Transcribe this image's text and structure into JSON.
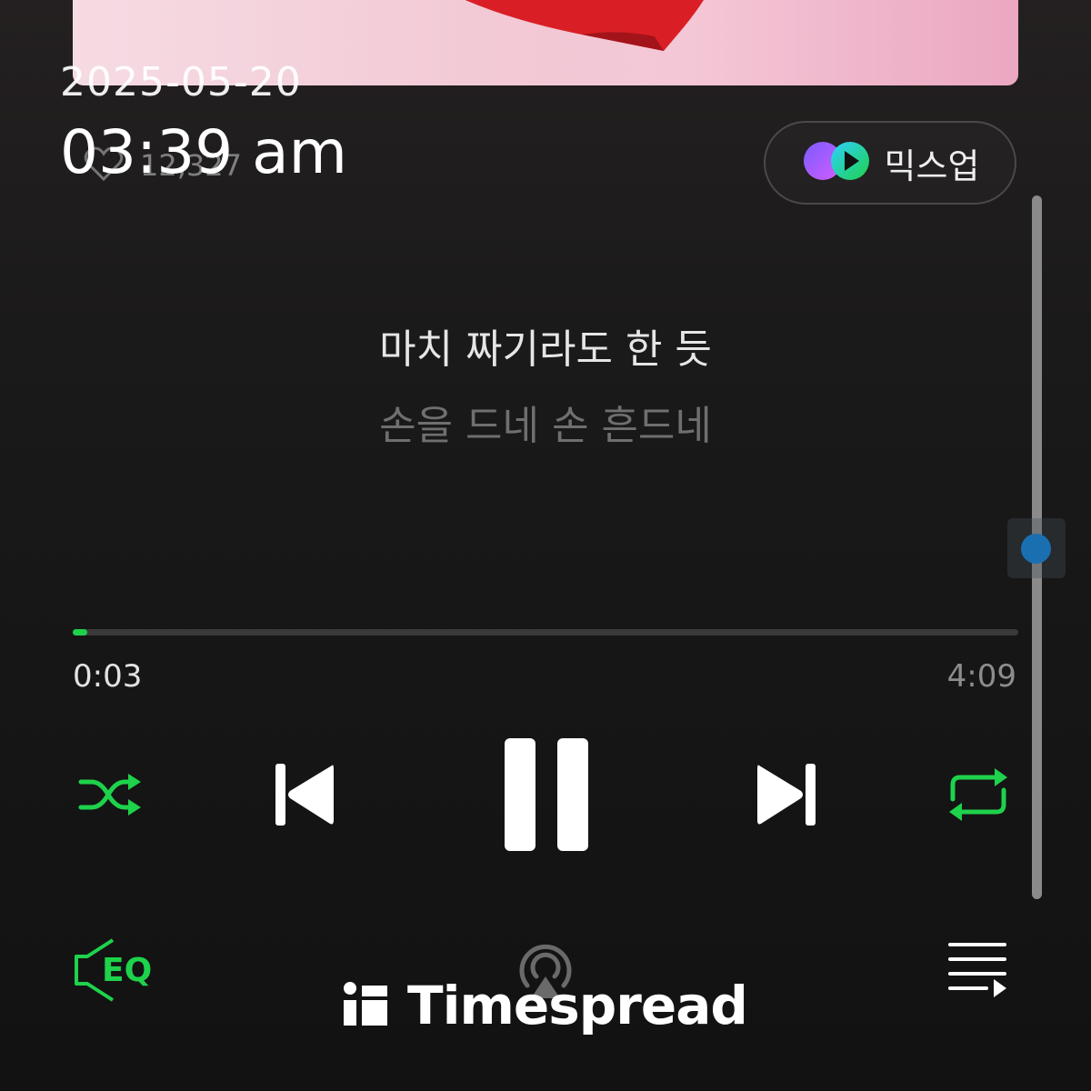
{
  "overlay": {
    "date": "2025-05-20",
    "time": "03:39 am"
  },
  "track": {
    "like_count": "12,327"
  },
  "mixup": {
    "label": "믹스업"
  },
  "lyrics": {
    "current": "마치 짜기라도 한 듯",
    "next": "손을 드네 손 흔드네"
  },
  "playback": {
    "elapsed": "0:03",
    "total": "4:09",
    "progress_fraction": 0.012
  },
  "scrollbar": {
    "position_fraction": 0.5
  },
  "controls": {
    "shuffle_icon": "shuffle-icon",
    "previous_icon": "skip-previous-icon",
    "pause_icon": "pause-icon",
    "next_icon": "skip-next-icon",
    "repeat_icon": "repeat-icon",
    "eq_label": "EQ",
    "cast_icon": "cast-icon",
    "queue_icon": "queue-icon"
  },
  "watermark": {
    "text": "Timespread"
  },
  "colors": {
    "accent": "#1ed24b",
    "background": "#151515",
    "scroll_handle": "#1a6fb0"
  }
}
